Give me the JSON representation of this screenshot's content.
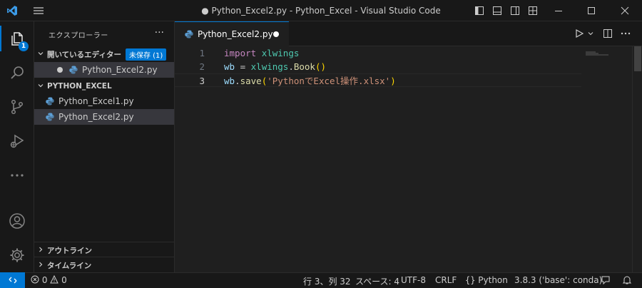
{
  "window": {
    "title": "● Python_Excel2.py - Python_Excel - Visual Studio Code"
  },
  "activity_bar": {
    "explorer_badge": "1",
    "items": [
      "explorer-icon",
      "search-icon",
      "source-control-icon",
      "run-debug-icon",
      "more-icon",
      "account-icon",
      "settings-gear-icon"
    ]
  },
  "sidebar": {
    "title": "エクスプローラー",
    "open_editors": {
      "label": "開いているエディター",
      "unsaved_badge": "未保存 (1)",
      "files": [
        {
          "name": "Python_Excel2.py",
          "dirty": true
        }
      ]
    },
    "project": {
      "label": "PYTHON_EXCEL",
      "files": [
        {
          "name": "Python_Excel1.py"
        },
        {
          "name": "Python_Excel2.py",
          "selected": true
        }
      ]
    },
    "outline_label": "アウトライン",
    "timeline_label": "タイムライン"
  },
  "editor": {
    "tab_label": "Python_Excel2.py",
    "lines": [
      {
        "number": "1",
        "tokens": [
          [
            "kw",
            "import"
          ],
          [
            "pl",
            " "
          ],
          [
            "mod",
            "xlwings"
          ]
        ]
      },
      {
        "number": "2",
        "tokens": [
          [
            "var",
            "wb"
          ],
          [
            "pl",
            " = "
          ],
          [
            "mod",
            "xlwings"
          ],
          [
            "pl",
            "."
          ],
          [
            "fn",
            "Book"
          ],
          [
            "par",
            "()"
          ]
        ]
      },
      {
        "number": "3",
        "tokens": [
          [
            "var",
            "wb"
          ],
          [
            "pl",
            "."
          ],
          [
            "fn",
            "save"
          ],
          [
            "par",
            "("
          ],
          [
            "str",
            "'PythonでExcel操作.xlsx'"
          ],
          [
            "par",
            ")"
          ]
        ]
      }
    ]
  },
  "status_bar": {
    "errors": "0",
    "warnings": "0",
    "position": "行 3、列 32",
    "spaces": "スペース: 4",
    "encoding": "UTF-8",
    "eol": "CRLF",
    "language": "Python",
    "interpreter": "3.8.3 ('base': conda)"
  },
  "colors": {
    "accent": "#0078d4",
    "background": "#1f1f1f",
    "chrome": "#181818"
  }
}
